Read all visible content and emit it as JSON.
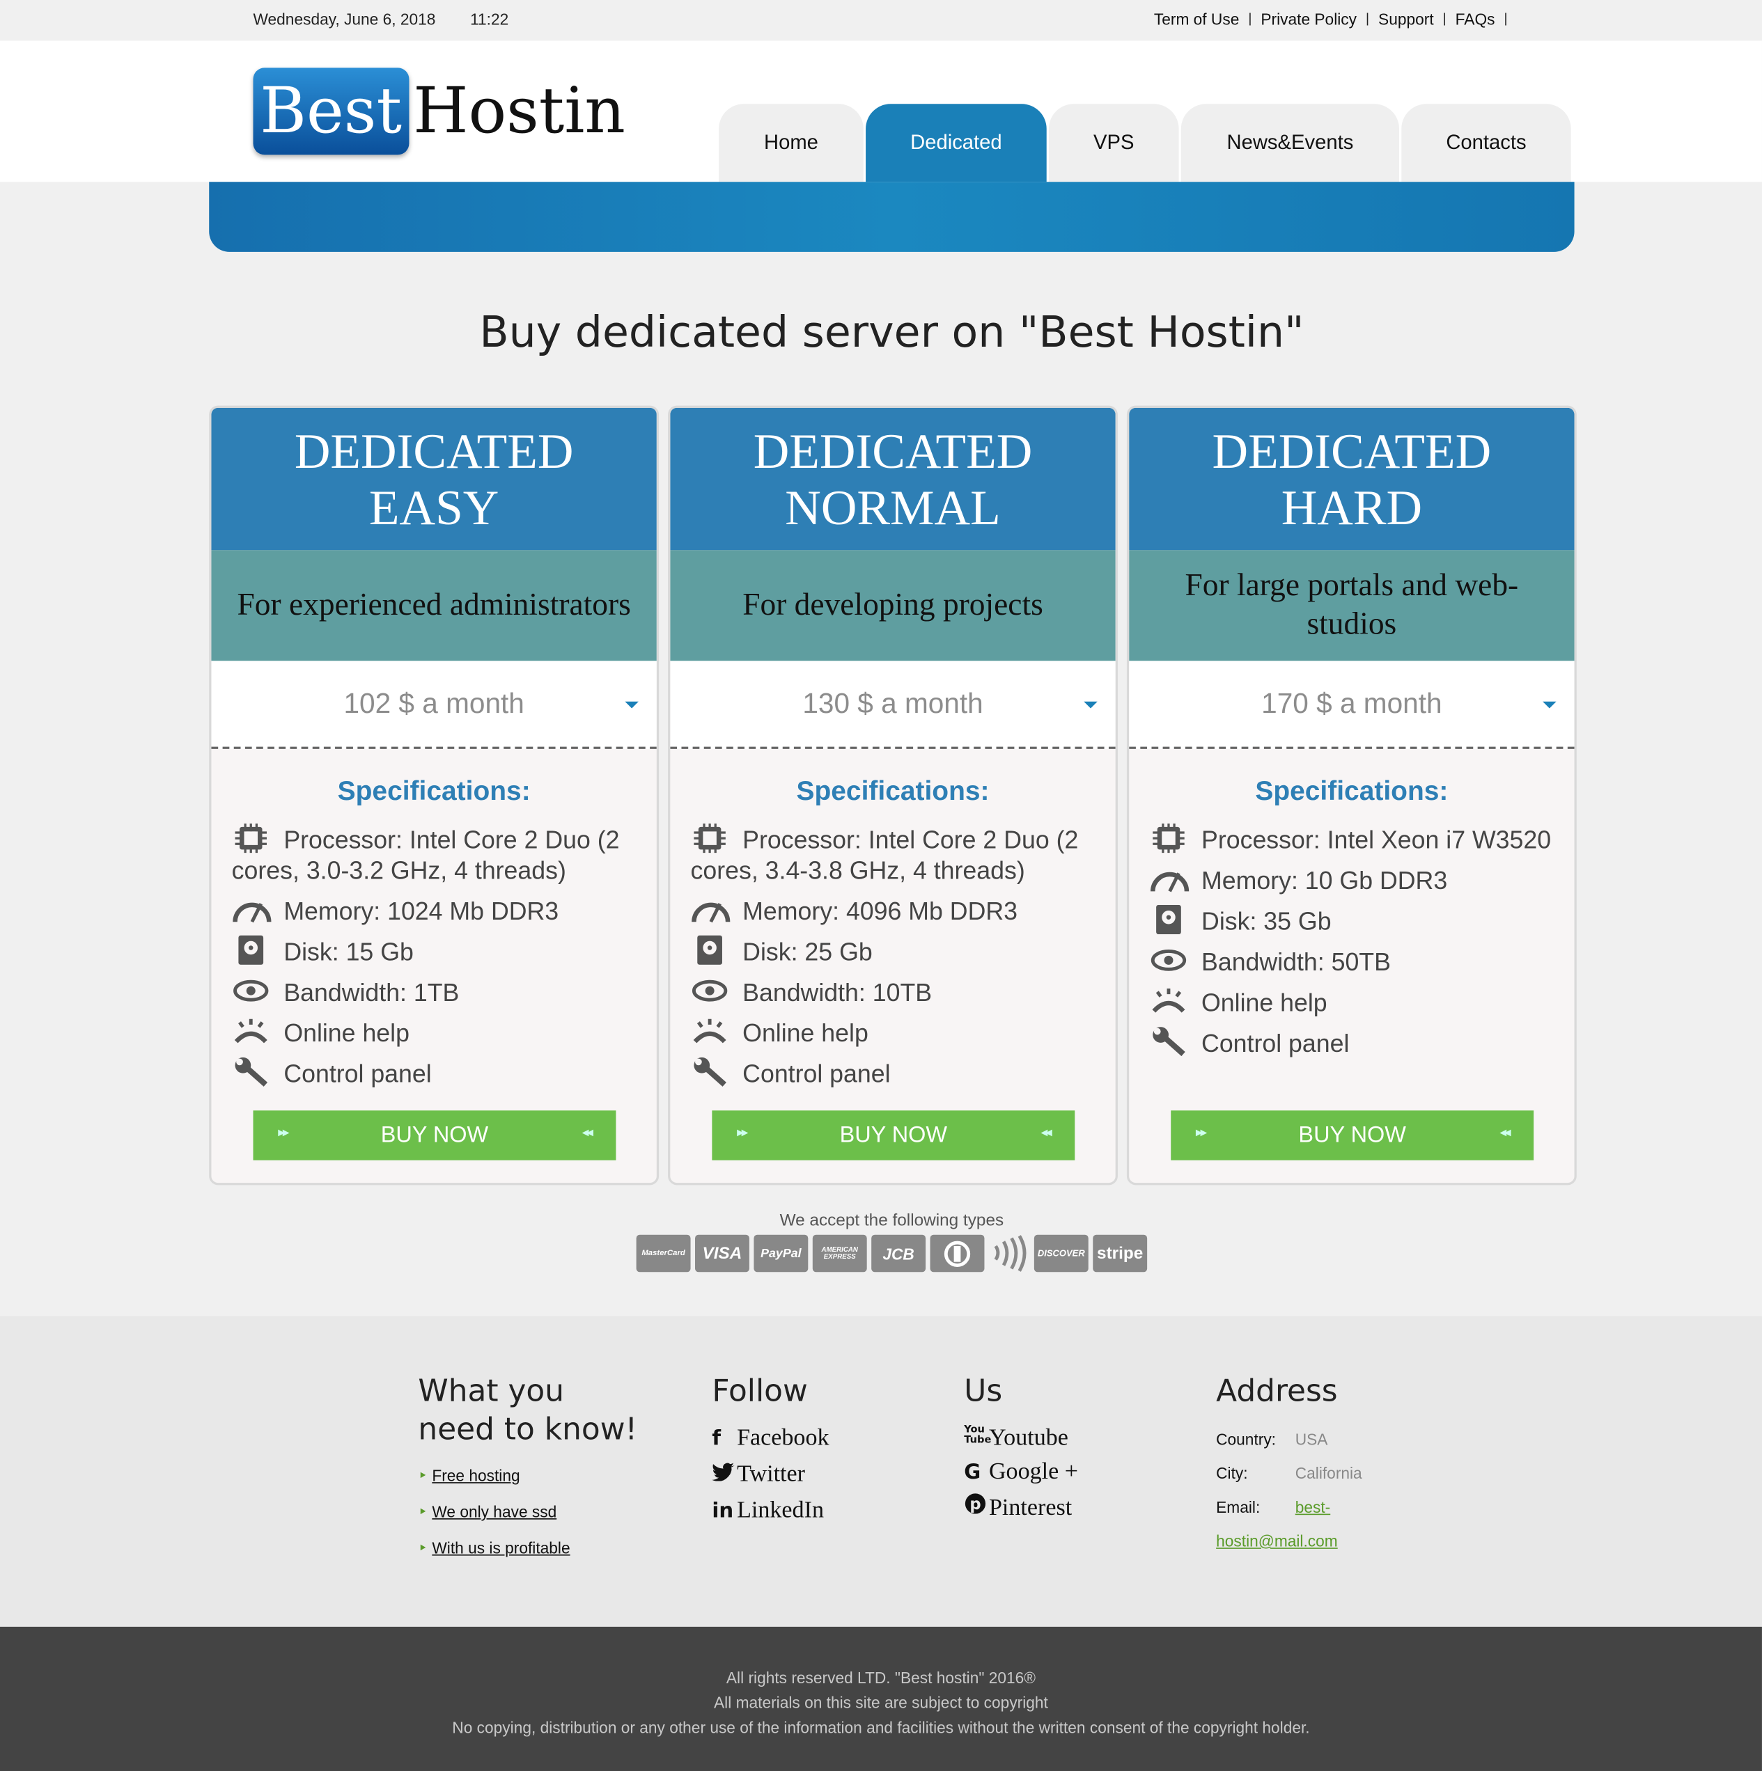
{
  "topbar": {
    "date": "Wednesday, June 6, 2018",
    "time": "11:22",
    "links": [
      "Term of Use",
      "Private Policy",
      "Support",
      "FAQs"
    ]
  },
  "logo": {
    "part1": "Best",
    "part2": "Hostin"
  },
  "nav": {
    "home": "Home",
    "dedicated": "Dedicated",
    "vps": "VPS",
    "news": "News&Events",
    "contacts": "Contacts"
  },
  "page_title": "Buy dedicated server on \"Best Hostin\"",
  "plans": [
    {
      "head_line1": "DEDICATED",
      "head_line2": "EASY",
      "subtitle": "For experienced administrators",
      "price": "102 $ a month",
      "spec_title": "Specifications:",
      "processor": "Processor: Intel Core 2 Duo (2 cores, 3.0-3.2 GHz, 4 threads)",
      "memory": "Memory: 1024 Mb DDR3",
      "disk": "Disk: 15 Gb",
      "bandwidth": "Bandwidth: 1TB",
      "help": "Online help",
      "panel": "Control panel",
      "buy": "BUY NOW"
    },
    {
      "head_line1": "DEDICATED",
      "head_line2": "NORMAL",
      "subtitle": "For developing projects",
      "price": "130 $ a month",
      "spec_title": "Specifications:",
      "processor": "Processor: Intel Core 2 Duo (2 cores, 3.4-3.8 GHz, 4 threads)",
      "memory": "Memory: 4096 Mb DDR3",
      "disk": "Disk: 25 Gb",
      "bandwidth": "Bandwidth: 10TB",
      "help": "Online help",
      "panel": "Control panel",
      "buy": "BUY NOW"
    },
    {
      "head_line1": "DEDICATED",
      "head_line2": "HARD",
      "subtitle": "For large portals and web-studios",
      "price": "170 $ a month",
      "spec_title": "Specifications:",
      "processor": "Processor: Intel Xeon i7 W3520",
      "memory": "Memory: 10 Gb DDR3",
      "disk": "Disk: 35 Gb",
      "bandwidth": "Bandwidth: 50TB",
      "help": "Online help",
      "panel": "Control panel",
      "buy": "BUY NOW"
    }
  ],
  "payments": {
    "label": "We accept the following types",
    "cards": [
      "MasterCard",
      "VISA",
      "PayPal",
      "AMERICAN EXPRESS",
      "JCB",
      "",
      "",
      "DISCOVER",
      "stripe"
    ]
  },
  "footer": {
    "know_title": "What you need to know!",
    "know_links": [
      "Free hosting",
      "We only have ssd",
      "With us is profitable"
    ],
    "follow_title": "Follow",
    "follow": [
      {
        "icon": "f",
        "label": "Facebook"
      },
      {
        "icon": "t",
        "label": "Twitter"
      },
      {
        "icon": "in",
        "label": "LinkedIn"
      }
    ],
    "us_title": "Us",
    "us": [
      {
        "icon": "yt",
        "label": "Youtube"
      },
      {
        "icon": "G",
        "label": "Google +"
      },
      {
        "icon": "P",
        "label": "Pinterest"
      }
    ],
    "address_title": "Address",
    "country_key": "Country:",
    "country": "USA",
    "city_key": "City:",
    "city": "California",
    "email_key": "Email:",
    "email": "best-hostin@mail.com"
  },
  "bottom": {
    "line1": "All rights reserved LTD. \"Best hostin\" 2016®",
    "line2": "All materials on this site are subject to copyright",
    "line3": "No copying, distribution or any other use of the information and facilities without the written consent of the copyright holder."
  },
  "colors": {
    "accent": "#1a80b8",
    "plan_head": "#2e7fb5",
    "plan_sub": "#5f9ea0",
    "buy": "#6cbf4a",
    "footer_dark": "#444444"
  }
}
